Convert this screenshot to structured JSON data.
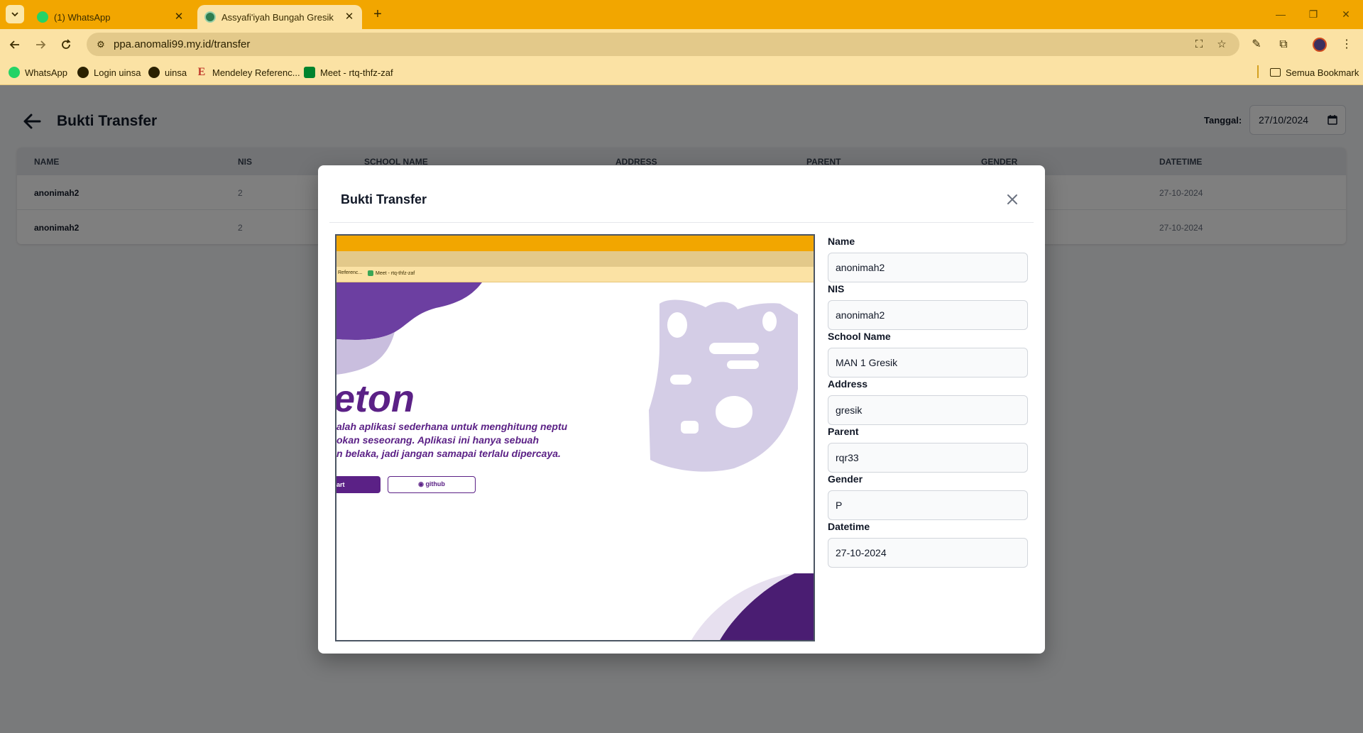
{
  "browser": {
    "tabs": [
      {
        "title": "(1) WhatsApp",
        "active": false
      },
      {
        "title": "Assyafi'iyah Bungah Gresik",
        "active": true
      }
    ],
    "url": "ppa.anomali99.my.id/transfer",
    "bookmarks": [
      "WhatsApp",
      "Login uinsa",
      "uinsa",
      "Mendeley Referenc...",
      "Meet - rtq-thfz-zaf"
    ],
    "all_bookmarks_label": "Semua Bookmark"
  },
  "page": {
    "title": "Bukti Transfer",
    "date_label": "Tanggal:",
    "date_value": "27/10/2024"
  },
  "table": {
    "headers": [
      "NAME",
      "NIS",
      "SCHOOL NAME",
      "ADDRESS",
      "PARENT",
      "GENDER",
      "DATETIME"
    ],
    "rows": [
      {
        "name": "anonimah2",
        "nis": "2",
        "datetime": "27-10-2024"
      },
      {
        "name": "anonimah2",
        "nis": "2",
        "datetime": "27-10-2024"
      }
    ]
  },
  "modal": {
    "title": "Bukti Transfer",
    "preview": {
      "bookmarks": [
        "Referenc...",
        "Meet - rtq-thfz-zaf"
      ],
      "heading": "eton",
      "lines": [
        "alah aplikasi sederhana untuk menghitung neptu",
        "okan seseorang. Aplikasi ini hanya sebuah",
        "n belaka, jadi jangan samapai terlalu dipercaya."
      ],
      "primary_button": "art",
      "secondary_button": "github"
    },
    "fields": [
      {
        "label": "Name",
        "value": "anonimah2"
      },
      {
        "label": "NIS",
        "value": "anonimah2"
      },
      {
        "label": "School Name",
        "value": "MAN 1 Gresik"
      },
      {
        "label": "Address",
        "value": "gresik"
      },
      {
        "label": "Parent",
        "value": "rqr33"
      },
      {
        "label": "Gender",
        "value": "P"
      },
      {
        "label": "Datetime",
        "value": "27-10-2024"
      }
    ]
  },
  "colors": {
    "chrome_accent": "#f2a600",
    "chrome_light": "#fbe2a4",
    "preview_purple": "#5b2186"
  }
}
